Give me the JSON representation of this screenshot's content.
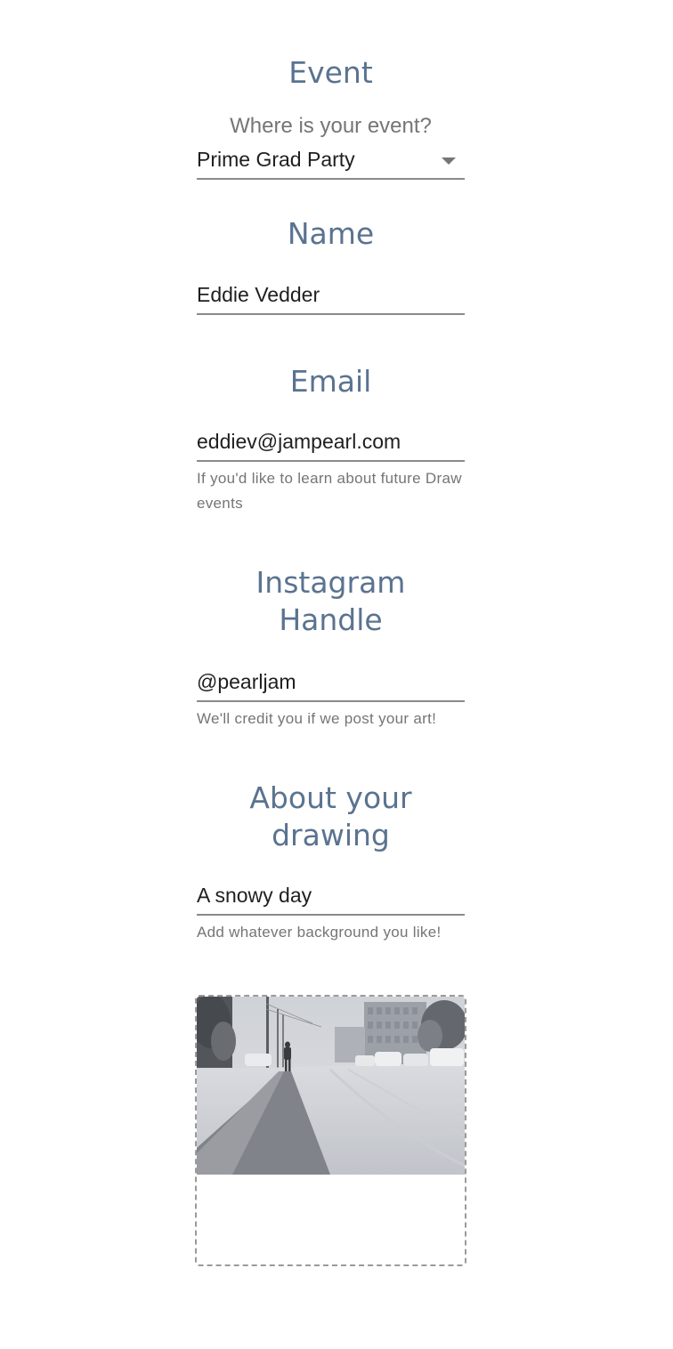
{
  "event": {
    "title": "Event",
    "prompt": "Where is your event?",
    "selected": "Prime Grad Party"
  },
  "name": {
    "title": "Name",
    "value": "Eddie Vedder"
  },
  "email": {
    "title": "Email",
    "value": "eddiev@jampearl.com",
    "helper": "If you'd like to learn about future Draw events"
  },
  "instagram": {
    "title_line1": "Instagram",
    "title_line2": "Handle",
    "value": "@pearljam",
    "helper": "We'll credit you if we post your art!"
  },
  "drawing": {
    "title_line1": "About your",
    "title_line2": "drawing",
    "value": "A snowy day",
    "helper": "Add whatever background you like!"
  },
  "upload": {
    "image_subject": "snowy street with a lone walker"
  },
  "colors": {
    "heading": "#5a7390",
    "helper_text": "#757575",
    "underline": "#8a8a8a",
    "dashed_border": "#9a9a9a"
  }
}
